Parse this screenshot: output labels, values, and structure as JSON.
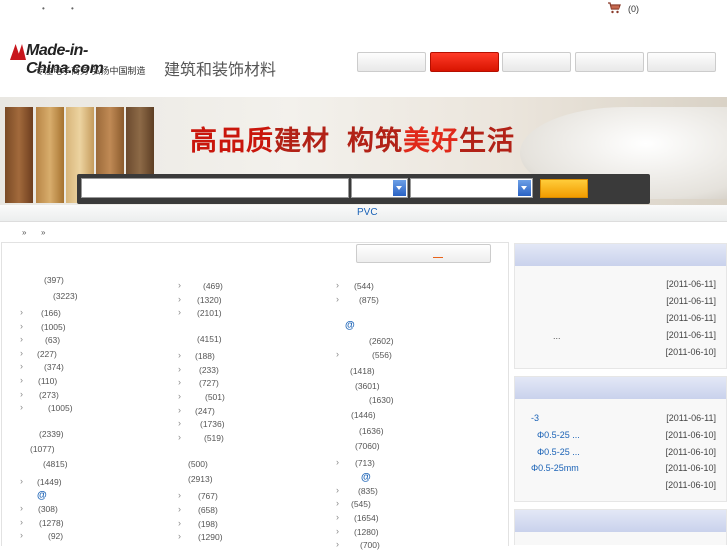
{
  "topbar": {
    "dot1": "•",
    "dot2": "•",
    "cart_icon": "cart-icon",
    "cart_count": "(0)"
  },
  "logo": {
    "brand": "Made-in-China.com",
    "slogan": "专注电子商务 弘扬中国制造"
  },
  "site_title": "建筑和装饰材料",
  "banner": {
    "text_a": "高品质",
    "text_b": "建材",
    "text_c": "构筑",
    "text_d": "美好",
    "text_e": "生活"
  },
  "pvc_label": "PVC",
  "breadcrumb": {
    "sep1": "»",
    "sep2": "»"
  },
  "counts": {
    "c1": [
      "(397)",
      "(3223)",
      "(166)",
      "(1005)",
      "(63)",
      "(227)",
      "(374)",
      "(110)",
      "(273)",
      "(1005)",
      "(2339)",
      "(1077)",
      "(4815)",
      "(1449)",
      "(308)",
      "(1278)",
      "(92)"
    ],
    "c2": [
      "(469)",
      "(1320)",
      "(2101)",
      "(4151)",
      "(188)",
      "(233)",
      "(727)",
      "(501)",
      "(247)",
      "(1736)",
      "(519)",
      "(500)",
      "(2913)",
      "(767)",
      "(658)",
      "(198)",
      "(1290)"
    ],
    "c3": [
      "(544)",
      "(875)",
      "(2602)",
      "(556)",
      "(1418)",
      "(3601)",
      "(1630)",
      "(1446)",
      "(1636)",
      "(7060)",
      "(713)",
      "(835)",
      "(545)",
      "(1654)",
      "(1280)",
      "(700)"
    ]
  },
  "at_symbol": "@",
  "right_panel1": {
    "ellipsis": "...",
    "dates": [
      "[2011-06-11]",
      "[2011-06-11]",
      "[2011-06-11]",
      "[2011-06-11]",
      "[2011-06-10]"
    ]
  },
  "right_panel2": {
    "links": [
      "-3",
      "Φ0.5-25 ...",
      "Φ0.5-25 ...",
      "Φ0.5-25mm"
    ],
    "dates": [
      "[2011-06-11]",
      "[2011-06-10]",
      "[2011-06-10]",
      "[2011-06-10]",
      "[2011-06-10]"
    ]
  },
  "colors": {
    "accent_red": "#d81400",
    "link_blue": "#1a62b6",
    "search_orange": "#f29c00"
  }
}
